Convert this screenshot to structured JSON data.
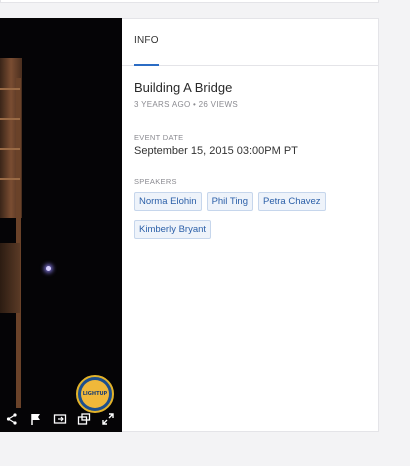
{
  "tabs": [
    {
      "label": "INFO"
    }
  ],
  "video": {
    "title": "Building A Bridge",
    "meta": "3 YEARS AGO • 26 VIEWS",
    "badge_text": "LIGHTUP"
  },
  "event": {
    "date_label": "EVENT DATE",
    "date_value": "September 15, 2015 03:00PM PT"
  },
  "speakers": {
    "label": "SPEAKERS",
    "items": [
      "Norma Elohin",
      "Phil Ting",
      "Petra Chavez",
      "Kimberly Bryant"
    ]
  },
  "colors": {
    "accent": "#2b6cc4",
    "chip_bg": "#eef3fa",
    "chip_text": "#2b5fa8",
    "video_bg": "#050406"
  },
  "icons": [
    "share-icon",
    "flag-icon",
    "embed-icon",
    "popout-icon",
    "fullscreen-icon"
  ]
}
